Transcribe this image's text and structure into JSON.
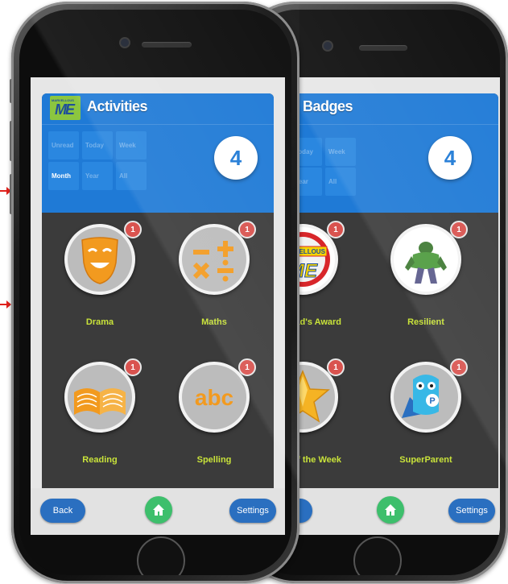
{
  "colors": {
    "header_blue": "#1f7ad6",
    "label_green": "#c9e33a",
    "badge_red": "#d9534f",
    "home_green": "#3dbf6c",
    "button_blue": "#2a6fc0",
    "arrow_red": "#e0201b"
  },
  "left_phone": {
    "logo_text": "MARVELLOUS",
    "logo_letters": "ME",
    "title": "Activities",
    "count": "4",
    "filters": [
      "Unread",
      "Today",
      "Week",
      "Month",
      "Year",
      "All"
    ],
    "active_filter": "Month",
    "items": [
      {
        "label": "Drama",
        "badge": "1",
        "icon": "theatre-mask-icon"
      },
      {
        "label": "Maths",
        "badge": "1",
        "icon": "math-symbols-icon"
      },
      {
        "label": "Reading",
        "badge": "1",
        "icon": "open-book-icon"
      },
      {
        "label": "Spelling",
        "badge": "1",
        "icon": "abc-icon"
      }
    ],
    "footer": {
      "back": "Back",
      "home_icon": "home-icon",
      "settings": "Settings"
    }
  },
  "right_phone": {
    "logo_letters": "ME",
    "title": "Badges",
    "count": "4",
    "filters": [
      "Today",
      "Week",
      "Year",
      "All"
    ],
    "items": [
      {
        "label": "lead's Award",
        "badge": "1",
        "icon": "marvellous-me-award-icon",
        "badge_text": "MARVELLOUS"
      },
      {
        "label": "Resilient",
        "badge": "1",
        "icon": "hulk-figure-icon"
      },
      {
        "label": "ar of the Week",
        "badge": "1",
        "icon": "gold-star-icon"
      },
      {
        "label": "SuperParent",
        "badge": "1",
        "icon": "superparent-mascot-icon"
      }
    ],
    "footer": {
      "back": "ck",
      "home_icon": "home-icon",
      "settings": "Settings"
    }
  }
}
